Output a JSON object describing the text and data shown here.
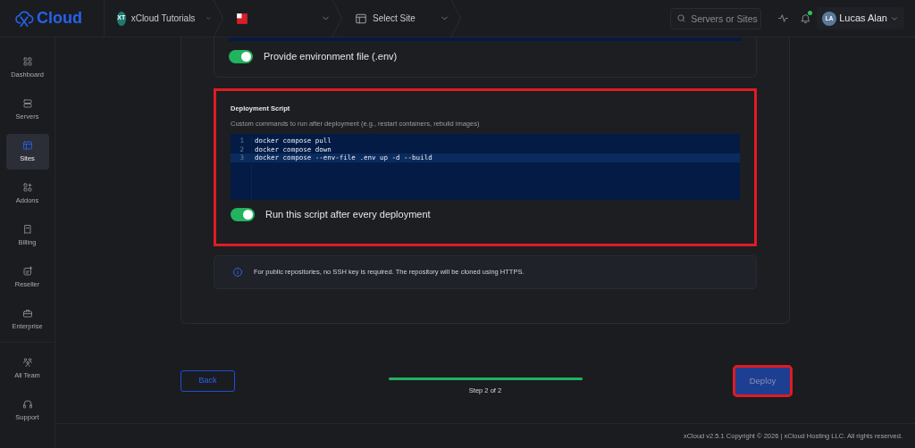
{
  "brand": {
    "name": "Cloud"
  },
  "topbar": {
    "breadcrumbs": [
      {
        "kind": "team",
        "badge": "XT",
        "label": "xCloud Tutorials"
      },
      {
        "kind": "flag"
      },
      {
        "kind": "site",
        "label": "Select Site"
      }
    ],
    "search": {
      "placeholder": "Servers or Sites"
    },
    "notifications": {
      "unread": true
    },
    "user": {
      "initials": "LA",
      "name": "Lucas Alan"
    }
  },
  "sidebar": {
    "groups": [
      {
        "items": [
          {
            "label": "Dashboard",
            "selected": false
          },
          {
            "label": "Servers",
            "selected": false
          },
          {
            "label": "Sites",
            "selected": true
          },
          {
            "label": "Addons",
            "selected": false
          },
          {
            "label": "Billing",
            "selected": false
          },
          {
            "label": "Reseller",
            "selected": false
          },
          {
            "label": "Enterprise",
            "selected": false
          }
        ]
      },
      {
        "items": [
          {
            "label": "All Team",
            "selected": false
          },
          {
            "label": "Support",
            "selected": false
          }
        ]
      }
    ]
  },
  "env_file": {
    "label": "Provide environment file (.env)",
    "on": true
  },
  "deployment_script": {
    "title": "Deployment Script",
    "description": "Custom commands to run after deployment (e.g., restart containers, rebuild images)",
    "highlighted": true,
    "lines": [
      {
        "number": "1",
        "code": "docker compose pull",
        "active": false
      },
      {
        "number": "2",
        "code": "docker compose down",
        "active": false
      },
      {
        "number": "3",
        "code": "docker compose --env-file .env up -d --build",
        "active": true
      }
    ],
    "toggle": {
      "label": "Run this script after every deployment",
      "on": true
    }
  },
  "info": {
    "text": "For public repositories, no SSH key is required. The repository will be cloned using HTTPS."
  },
  "wizard": {
    "back": "Back",
    "progress": {
      "level": 1
    },
    "step": "Step 2 of 2",
    "deploy": {
      "label": "Deploy",
      "disabled": true,
      "highlighted": true
    }
  },
  "footer": {
    "copyright": "xCloud v2.5.1 Copyright © 2026 | xCloud Hosting LLC. All rights reserved."
  }
}
